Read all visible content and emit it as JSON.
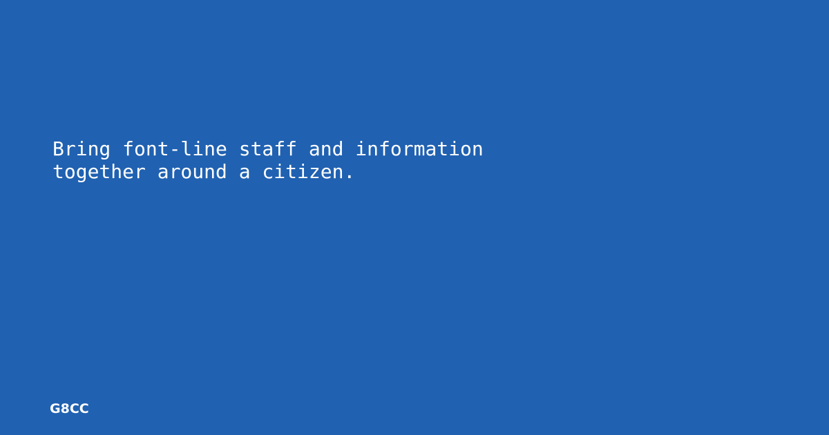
{
  "colors": {
    "background": "#2061b1",
    "text": "#ffffff"
  },
  "tagline": {
    "lines": [
      "Bring font-line staff and information",
      "together around a citizen."
    ]
  },
  "brand": {
    "label": "G8CC"
  }
}
